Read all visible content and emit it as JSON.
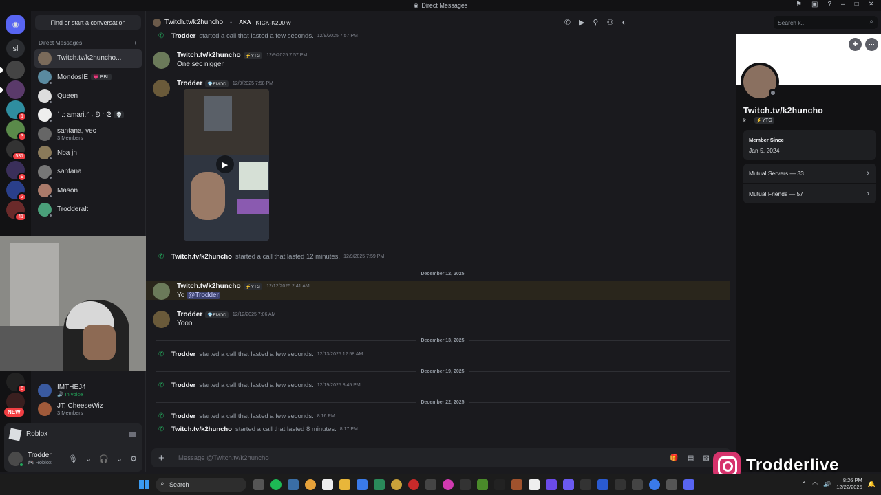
{
  "titlebar": {
    "title": "Direct Messages"
  },
  "servers": [
    {
      "icon": "sl"
    },
    {
      "badge": ""
    },
    {
      "badge": ""
    },
    {
      "badge": "1"
    },
    {
      "badge": "3"
    },
    {
      "badge": "531"
    },
    {
      "badge": "9"
    },
    {
      "badge": "2"
    },
    {
      "badge": "41"
    },
    {
      "badge": "8"
    }
  ],
  "new_label": "NEW",
  "dms": {
    "find_button": "Find or start a conversation",
    "header": "Direct Messages",
    "add": "+",
    "items": [
      {
        "name": "Twitch.tv/k2huncho...",
        "active": true
      },
      {
        "name": "MondosIE",
        "tag": "💗 BBL"
      },
      {
        "name": "Queen"
      },
      {
        "name": "ʿ .: amari.ᐟ ˒ ⅁ ˑ ᘓ",
        "tag": "💀"
      },
      {
        "name": "santana, vec",
        "sub": "3 Members"
      },
      {
        "name": "Nba jn"
      },
      {
        "name": "santana"
      },
      {
        "name": "Mason"
      },
      {
        "name": "Trodderalt"
      }
    ],
    "lower_items": [
      {
        "name": "IMTHEJ4",
        "sub": "🔊 In voice"
      },
      {
        "name": "JT, CheeseWiz",
        "sub": "3 Members"
      }
    ]
  },
  "activity": {
    "game": "Roblox"
  },
  "user": {
    "name": "Trodder",
    "status": "🎮 Roblox"
  },
  "chat": {
    "recipient": "Twitch.tv/k2huncho",
    "aka_label": "AKA",
    "aka_names": "KICK-K290 w",
    "search_placeholder": "Search k...",
    "composer_placeholder": "Message @Twitch.tv/k2huncho",
    "messages": [
      {
        "kind": "call",
        "who": "Trodder",
        "text": "started a call that lasted a few seconds.",
        "ts": "12/9/2025 7:57 PM"
      },
      {
        "kind": "msg",
        "who": "Twitch.tv/k2huncho",
        "tag": "⚡YTG",
        "ts": "12/9/2025 7:57 PM",
        "body": "One sec nigger"
      },
      {
        "kind": "msg",
        "who": "Trodder",
        "tag": "💎EMOD",
        "ts": "12/9/2025 7:58 PM",
        "body": ""
      },
      {
        "kind": "call",
        "who": "Twitch.tv/k2huncho",
        "text": "started a call that lasted 12 minutes.",
        "ts": "12/9/2025 7:59 PM"
      },
      {
        "kind": "divider",
        "label": "December 12, 2025"
      },
      {
        "kind": "msg",
        "who": "Twitch.tv/k2huncho",
        "tag": "⚡YTG",
        "ts": "12/12/2025 2:41 AM",
        "body": "Yo",
        "mention": "@Trodder"
      },
      {
        "kind": "msg",
        "who": "Trodder",
        "tag": "💎EMOD",
        "ts": "12/12/2025 7:06 AM",
        "body": "Yooo"
      },
      {
        "kind": "divider",
        "label": "December 13, 2025"
      },
      {
        "kind": "call",
        "who": "Trodder",
        "text": "started a call that lasted a few seconds.",
        "ts": "12/13/2025 12:58 AM"
      },
      {
        "kind": "divider",
        "label": "December 19, 2025"
      },
      {
        "kind": "call",
        "who": "Trodder",
        "text": "started a call that lasted a few seconds.",
        "ts": "12/19/2025 8:45 PM"
      },
      {
        "kind": "divider",
        "label": "December 22, 2025"
      },
      {
        "kind": "call",
        "who": "Trodder",
        "text": "started a call that lasted a few seconds.",
        "ts": "8:16 PM"
      },
      {
        "kind": "call",
        "who": "Twitch.tv/k2huncho",
        "text": "started a call that lasted 8 minutes.",
        "ts": "8:17 PM"
      }
    ]
  },
  "profile": {
    "name": "Twitch.tv/k2huncho",
    "handle": "k...",
    "tag": "⚡YTG",
    "member_since_label": "Member Since",
    "member_since": "Jan 5, 2024",
    "mutual_servers": "Mutual Servers — 33",
    "mutual_friends": "Mutual Friends — 57"
  },
  "taskbar": {
    "search": "Search",
    "time": "8:26 PM",
    "date": "12/22/2025"
  },
  "overlay": {
    "instagram": "Trodderlive"
  },
  "colors": {
    "accent": "#5865f2",
    "call_green": "#23a55a",
    "badge_red": "#f23f43"
  }
}
